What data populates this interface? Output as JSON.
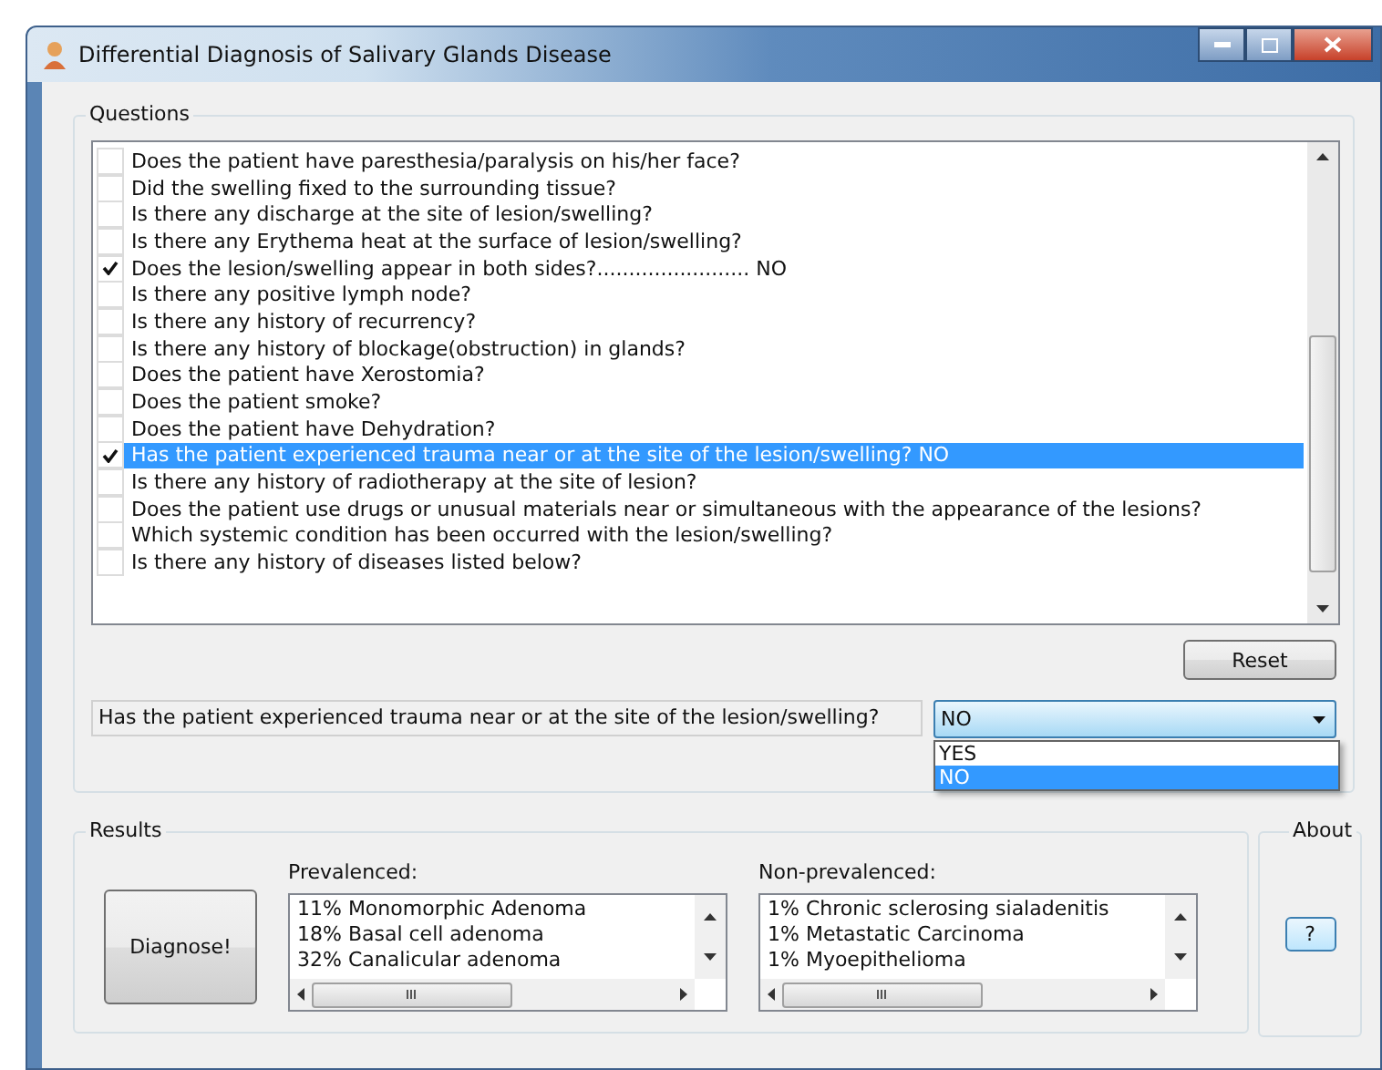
{
  "window": {
    "title": "Differential Diagnosis of Salivary Glands Disease"
  },
  "questions": {
    "title": "Questions",
    "items": [
      {
        "text": "Does the patient have paresthesia/paralysis on his/her face?",
        "checked": false,
        "selected": false
      },
      {
        "text": "Did the swelling fixed to the surrounding tissue?",
        "checked": false,
        "selected": false
      },
      {
        "text": "Is there any discharge at the site of lesion/swelling?",
        "checked": false,
        "selected": false
      },
      {
        "text": "Is there any Erythema  heat at the surface of lesion/swelling?",
        "checked": false,
        "selected": false
      },
      {
        "text": "Does the lesion/swelling appear in both sides?........................ NO",
        "checked": true,
        "selected": false
      },
      {
        "text": "Is there any positive lymph node?",
        "checked": false,
        "selected": false
      },
      {
        "text": "Is there any history of recurrency?",
        "checked": false,
        "selected": false
      },
      {
        "text": "Is there any history of blockage(obstruction) in glands?",
        "checked": false,
        "selected": false
      },
      {
        "text": "Does the patient have Xerostomia?",
        "checked": false,
        "selected": false
      },
      {
        "text": "Does the patient smoke?",
        "checked": false,
        "selected": false
      },
      {
        "text": "Does the patient have Dehydration?",
        "checked": false,
        "selected": false
      },
      {
        "text": "Has the patient experienced trauma near or at the site of the lesion/swelling? NO",
        "checked": true,
        "selected": true
      },
      {
        "text": "Is there any history of radiotherapy at the site of lesion?",
        "checked": false,
        "selected": false
      },
      {
        "text": "Does the patient use  drugs or unusual materials near or simultaneous with the appearance of the lesions?",
        "checked": false,
        "selected": false
      },
      {
        "text": "Which systemic condition has been occurred with the lesion/swelling?",
        "checked": false,
        "selected": false
      },
      {
        "text": "Is there any history of diseases listed below?",
        "checked": false,
        "selected": false
      }
    ],
    "reset_button": "Reset",
    "current_question": "Has the patient experienced trauma near or at the site of the lesion/swelling?",
    "answer": {
      "value": "NO",
      "options": [
        {
          "label": "YES",
          "selected": false
        },
        {
          "label": "NO",
          "selected": true
        }
      ]
    }
  },
  "results": {
    "title": "Results",
    "diagnose_button": "Diagnose!",
    "prevalenced": {
      "label": "Prevalenced:",
      "items": [
        "11% Monomorphic Adenoma",
        "18% Basal cell adenoma",
        "32% Canalicular adenoma"
      ]
    },
    "non_prevalenced": {
      "label": "Non-prevalenced:",
      "items": [
        "1% Chronic sclerosing sialadenitis",
        "1% Metastatic Carcinoma",
        "1% Myoepithelioma"
      ]
    }
  },
  "about": {
    "title": "About",
    "button": "?"
  }
}
